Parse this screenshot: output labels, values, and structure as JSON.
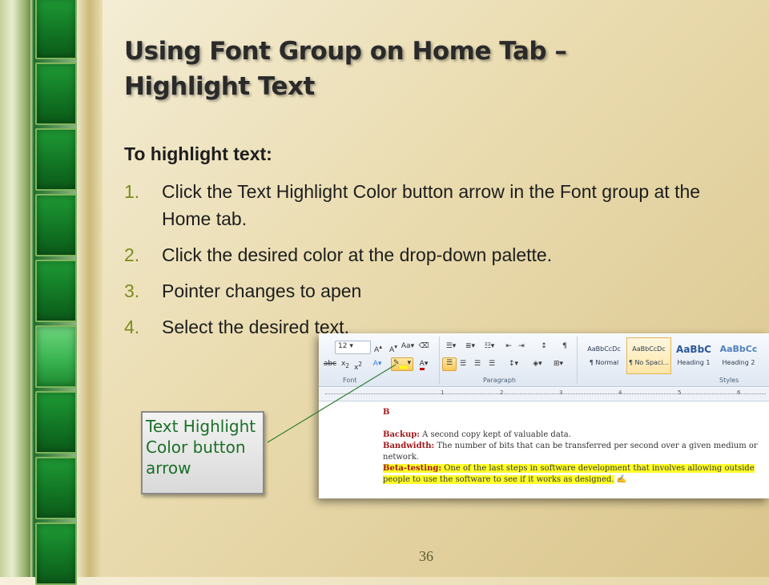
{
  "slide": {
    "title_line1": "Using Font Group on Home Tab –",
    "title_line2": "Highlight Text",
    "intro": "To highlight text:",
    "steps": [
      {
        "num": "1.",
        "text": "Click the Text Highlight Color button arrow in the Font group at the Home tab."
      },
      {
        "num": "2.",
        "text": "Click the desired color at the drop-down palette."
      },
      {
        "num": "3.",
        "text": "Pointer changes to apen"
      },
      {
        "num": "4.",
        "text": "Select the desired text."
      }
    ],
    "callout": "Text Highlight Color button arrow",
    "page_number": "36"
  },
  "ribbon": {
    "font_size": "12",
    "font_label": "Font",
    "paragraph_label": "Paragraph",
    "styles_label": "Styles",
    "styles": [
      {
        "preview": "AaBbCcDc",
        "name": "¶ Normal",
        "selected": false
      },
      {
        "preview": "AaBbCcDc",
        "name": "¶ No Spaci...",
        "selected": true
      },
      {
        "preview": "AaBbC",
        "name": "Heading 1",
        "selected": false
      },
      {
        "preview": "AaBbCc",
        "name": "Heading 2",
        "selected": false
      }
    ],
    "highlight_color": "#ffff00",
    "font_color": "#c00000"
  },
  "ruler": {
    "marks": [
      "1",
      "2",
      "3",
      "4",
      "5",
      "6"
    ]
  },
  "document": {
    "letter": "B",
    "entries": [
      {
        "term": "Backup:",
        "definition": " A second copy kept of valuable data.",
        "highlighted": false
      },
      {
        "term": "Bandwidth:",
        "definition": " The number of bits that can be transferred per second over a given medium or network.",
        "highlighted": false
      },
      {
        "term": "Beta-testing:",
        "definition": " One of the last steps in software development that involves allowing outside people to use the software to see if it works as designed.",
        "highlighted": true
      }
    ]
  },
  "colors": {
    "accent_number": "#7c8a1f",
    "callout_text": "#1b6f26",
    "doc_term": "#a0171b"
  }
}
